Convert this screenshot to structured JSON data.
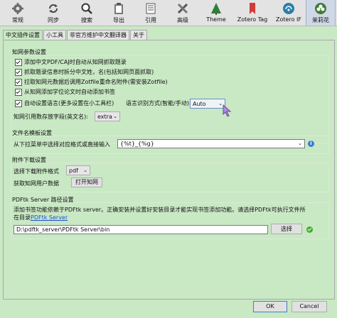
{
  "toolbar": {
    "items": [
      {
        "label": "常规",
        "icon": "gear-icon"
      },
      {
        "label": "同步",
        "icon": "sync-icon"
      },
      {
        "label": "搜索",
        "icon": "search-icon"
      },
      {
        "label": "导出",
        "icon": "clipboard-icon"
      },
      {
        "label": "引用",
        "icon": "cite-icon"
      },
      {
        "label": "高级",
        "icon": "tools-icon"
      },
      {
        "label": "Theme",
        "icon": "theme-icon"
      },
      {
        "label": "Zotero Tag",
        "icon": "tag-icon"
      },
      {
        "label": "Zotero IF",
        "icon": "if-icon"
      },
      {
        "label": "茉莉花",
        "icon": "jasmine-icon"
      }
    ]
  },
  "tabs": [
    "中文插件设置",
    "小工具",
    "非官方维护中文翻译器",
    "关于"
  ],
  "cnki": {
    "title": "知网参数设置",
    "options": [
      "添加中文PDF/CAJ时自动从知网抓取题录",
      "抓取题录信息时拆分中文姓，名(包括知网页面抓取)",
      "拉取知网元数据后调用Zotfile重命名附件(需安装Zotfile)",
      "从知网添加学位论文时自动添加书签",
      "自动设置语言(更多设置在小工具栏)"
    ],
    "lang_mode_label": "语言识别方式(智能/手动):",
    "lang_mode_value": "Auto",
    "citation_label": "知网引用数存放字段(英文名):",
    "citation_value": "extra"
  },
  "filename": {
    "title": "文件名模板设置",
    "label": "从下拉菜单中选择对应格式或直接输入",
    "value": "{%t}_{%g}",
    "info": "i"
  },
  "download": {
    "title": "附件下载设置",
    "format_label": "选择下载附件格式",
    "format_value": "pdf",
    "userdata_label": "获取知网用户数据",
    "open_button": "打开知网"
  },
  "pdftk": {
    "title": "PDFtk Server 路径设置",
    "desc_line1": "添加书签功能依赖于PDFtk server。正确安装并设置好安装目录才能实现书签添加功能。请选择PDFtk可执行文件所",
    "desc_line2_prefix": "在目录 ",
    "desc_link": "PDFtk Server",
    "path_value": "D:\\pdftk_server\\PDFtk Server\\bin",
    "choose_button": "选择"
  },
  "footer": {
    "ok": "OK",
    "cancel": "Cancel"
  },
  "colors": {
    "panel_bg": "#c9e8c4",
    "link": "#1a4fd6",
    "status_ok": "#4aa838",
    "info": "#3b7ad8"
  }
}
